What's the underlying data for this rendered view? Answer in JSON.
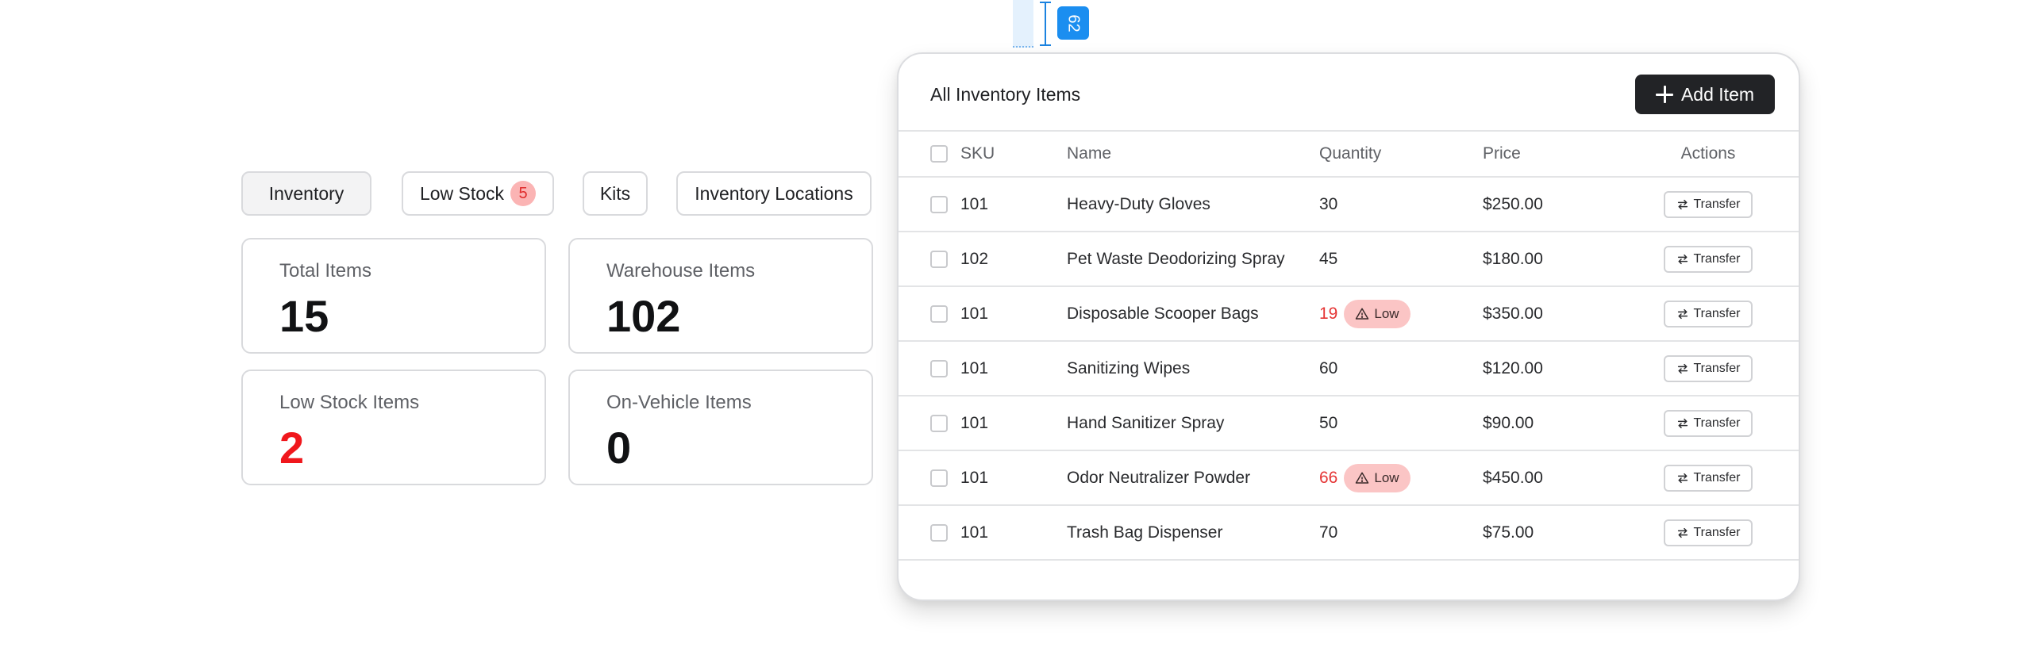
{
  "measurement": {
    "value": "62"
  },
  "tabs": [
    {
      "label": "Inventory",
      "active": true
    },
    {
      "label": "Low Stock",
      "badge": "5"
    },
    {
      "label": "Kits"
    },
    {
      "label": "Inventory Locations"
    }
  ],
  "stats": {
    "total_items": {
      "label": "Total Items",
      "value": "15"
    },
    "warehouse_items": {
      "label": "Warehouse Items",
      "value": "102"
    },
    "low_stock_items": {
      "label": "Low Stock Items",
      "value": "2"
    },
    "on_vehicle_items": {
      "label": "On-Vehicle Items",
      "value": "0"
    }
  },
  "inventory": {
    "title": "All Inventory Items",
    "add_button_label": "Add Item",
    "columns": {
      "sku": "SKU",
      "name": "Name",
      "quantity": "Quantity",
      "price": "Price",
      "actions": "Actions"
    },
    "low_label": "Low",
    "transfer_label": "Transfer",
    "rows": [
      {
        "sku": "101",
        "name": "Heavy-Duty Gloves",
        "quantity": "30",
        "low": false,
        "price": "$250.00"
      },
      {
        "sku": "102",
        "name": "Pet Waste Deodorizing Spray",
        "quantity": "45",
        "low": false,
        "price": "$180.00"
      },
      {
        "sku": "101",
        "name": "Disposable Scooper Bags",
        "quantity": "19",
        "low": true,
        "price": "$350.00"
      },
      {
        "sku": "101",
        "name": "Sanitizing Wipes",
        "quantity": "60",
        "low": false,
        "price": "$120.00"
      },
      {
        "sku": "101",
        "name": "Hand Sanitizer Spray",
        "quantity": "50",
        "low": false,
        "price": "$90.00"
      },
      {
        "sku": "101",
        "name": "Odor Neutralizer Powder",
        "quantity": "66",
        "low": true,
        "price": "$450.00"
      },
      {
        "sku": "101",
        "name": "Trash Bag Dispenser",
        "quantity": "70",
        "low": false,
        "price": "$75.00"
      }
    ]
  },
  "colors": {
    "accent_dark": "#222326",
    "danger": "#f0171c",
    "low_badge_bg": "#fbc5c5",
    "measure_blue": "#1b8ef0"
  },
  "icons": {
    "add": "plus-icon",
    "low": "warning-triangle-icon",
    "transfer": "swap-arrows-icon"
  }
}
